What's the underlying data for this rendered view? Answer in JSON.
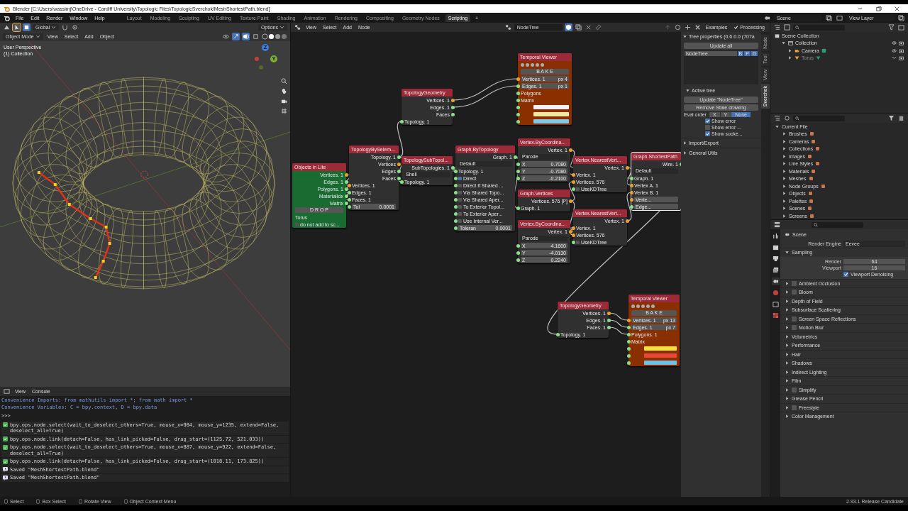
{
  "window": {
    "title": "Blender [C:\\Users\\wassimj\\OneDrive - Cardiff University\\Topologic Files\\TopologicSverchok\\MeshShortestPath.blend]"
  },
  "menu": [
    "File",
    "Edit",
    "Render",
    "Window",
    "Help"
  ],
  "workspaces": [
    {
      "label": "Layout",
      "selected": false
    },
    {
      "label": "Modeling",
      "selected": false
    },
    {
      "label": "Sculpting",
      "selected": false
    },
    {
      "label": "UV Editing",
      "selected": false
    },
    {
      "label": "Texture Paint",
      "selected": false
    },
    {
      "label": "Shading",
      "selected": false
    },
    {
      "label": "Animation",
      "selected": false
    },
    {
      "label": "Rendering",
      "selected": false
    },
    {
      "label": "Compositing",
      "selected": false
    },
    {
      "label": "Geometry Nodes",
      "selected": false
    },
    {
      "label": "Scripting",
      "selected": true
    }
  ],
  "add_tab": "+",
  "scene": "Scene",
  "view_layer": "View Layer",
  "viewport": {
    "transform": "Global",
    "options": "Options",
    "mode": "Object Mode",
    "menu": [
      "View",
      "Select",
      "Add",
      "Object"
    ],
    "overlay": [
      "User Perspective",
      "(1) Collection"
    ],
    "gizmo": [
      "Z",
      "Y"
    ]
  },
  "console": {
    "menu": [
      "View",
      "Console"
    ],
    "lines": [
      {
        "kind": "info",
        "text": "Convenience Imports:   from mathutils import *; from math import *"
      },
      {
        "kind": "info",
        "text": "Convenience Variables: C = bpy.context, D = bpy.data"
      },
      {
        "kind": "prompt",
        "text": ">>>"
      },
      {
        "kind": "op",
        "text": "bpy.ops.node.select(wait_to_deselect_others=True, mouse_x=984, mouse_y=1235, extend=False, deselect_all=True)"
      },
      {
        "kind": "op",
        "text": "bpy.ops.node.link(detach=False, has_link_picked=False, drag_start=(1125.72, 521.033))"
      },
      {
        "kind": "op",
        "text": "bpy.ops.node.select(wait_to_deselect_others=True, mouse_x=887, mouse_y=922, extend=False, deselect_all=True)"
      },
      {
        "kind": "op",
        "text": "bpy.ops.node.link(detach=False, has_link_picked=False, drag_start=(1018.11, 173.825))"
      },
      {
        "kind": "saved",
        "text": "Saved \"MeshShortestPath.blend\""
      },
      {
        "kind": "saved",
        "text": "Saved \"MeshShortestPath.blend\""
      }
    ]
  },
  "node_editor": {
    "menu": [
      "View",
      "Select",
      "Add",
      "Node"
    ],
    "tree": "NodeTree",
    "examples": "Examples",
    "processing": {
      "label": "Processing",
      "checked": true
    },
    "nodes": [
      {
        "title": "Objects in Lite",
        "kind": "objects",
        "selected": false,
        "rows": [
          {
            "kind": "socket",
            "input": false,
            "output": true,
            "text": "Vertices. 1"
          },
          {
            "kind": "socket",
            "input": false,
            "output": true,
            "text": "Edges. 1"
          },
          {
            "kind": "socket",
            "input": false,
            "output": true,
            "text": "Polygons. 1"
          },
          {
            "kind": "socket",
            "input": false,
            "output": true,
            "text": "MaterialIdx"
          },
          {
            "kind": "socket",
            "input": false,
            "output": true,
            "text": "Matrix"
          },
          {
            "kind": "button",
            "input": false,
            "output": false,
            "text": "D R O P"
          },
          {
            "kind": "socket",
            "input": false,
            "output": false,
            "text": "Torus"
          },
          {
            "kind": "check",
            "input": false,
            "output": false,
            "text": "do not add to sc...",
            "checked": false
          }
        ]
      },
      {
        "title": "TopologyBySelem...",
        "kind": "normal",
        "selected": false,
        "rows": [
          {
            "kind": "socket",
            "input": false,
            "output": true,
            "text": "Topology. 1"
          },
          {
            "kind": "socket",
            "input": false,
            "output": true,
            "text": "Vertices"
          },
          {
            "kind": "socket",
            "input": false,
            "output": true,
            "text": "Edges"
          },
          {
            "kind": "socket",
            "input": false,
            "output": true,
            "text": "Faces"
          },
          {
            "kind": "socket",
            "input": true,
            "output": false,
            "text": "Vertices. 1"
          },
          {
            "kind": "socket",
            "input": true,
            "output": false,
            "text": "Edges. 1"
          },
          {
            "kind": "socket",
            "input": true,
            "output": false,
            "text": "Faces. 1"
          },
          {
            "kind": "field",
            "input": true,
            "output": false,
            "text": "Tol",
            "value": "0.0001"
          }
        ]
      },
      {
        "title": "TopologyGeometry",
        "kind": "normal",
        "selected": false,
        "rows": [
          {
            "kind": "socket",
            "input": false,
            "output": true,
            "text": "Vertices. 1"
          },
          {
            "kind": "socket",
            "input": false,
            "output": true,
            "text": "Edges. 1"
          },
          {
            "kind": "socket",
            "input": false,
            "output": true,
            "text": "Faces"
          },
          {
            "kind": "socket",
            "input": true,
            "output": false,
            "text": "Topology. 1"
          }
        ]
      },
      {
        "title": "Temporal Viewer",
        "kind": "viewer",
        "selected": false,
        "rows": [
          {
            "kind": "button",
            "input": false,
            "output": false,
            "text": "B A K E"
          },
          {
            "kind": "field",
            "input": true,
            "output": false,
            "text": "Vertices. 1",
            "value": "px 4"
          },
          {
            "kind": "field",
            "input": true,
            "output": false,
            "text": "Edges. 1",
            "value": "px 1"
          },
          {
            "kind": "socket",
            "input": true,
            "output": false,
            "text": "Polygons"
          },
          {
            "kind": "socket",
            "input": true,
            "output": false,
            "text": "Matrix"
          },
          {
            "kind": "swatch",
            "input": true,
            "output": false,
            "color": "#f4f0f8"
          },
          {
            "kind": "swatch",
            "input": true,
            "output": false,
            "color": "#f0e8a0"
          },
          {
            "kind": "swatch",
            "input": true,
            "output": false,
            "color": "#80c8e8"
          }
        ]
      },
      {
        "title": "TopologySubTopol...",
        "kind": "normal",
        "selected": false,
        "rows": [
          {
            "kind": "socket",
            "input": false,
            "output": true,
            "text": "SubTopologies. 1"
          },
          {
            "kind": "dropdown",
            "input": false,
            "output": false,
            "text": "Shell"
          },
          {
            "kind": "socket",
            "input": true,
            "output": false,
            "text": "Topology. 1"
          }
        ]
      },
      {
        "title": "Graph.ByTopology",
        "kind": "normal",
        "selected": false,
        "rows": [
          {
            "kind": "socket",
            "input": false,
            "output": true,
            "text": "Graph. 1"
          },
          {
            "kind": "dropdown",
            "input": false,
            "output": false,
            "text": "Default"
          },
          {
            "kind": "socket",
            "input": true,
            "output": false,
            "text": "Topology. 1"
          },
          {
            "kind": "check",
            "input": true,
            "output": false,
            "text": "Direct",
            "checked": true
          },
          {
            "kind": "check",
            "input": true,
            "output": false,
            "text": "Direct If Shared ...",
            "checked": false
          },
          {
            "kind": "check",
            "input": true,
            "output": false,
            "text": "Via Shared Topo...",
            "checked": false
          },
          {
            "kind": "check",
            "input": true,
            "output": false,
            "text": "Via Shared Aper...",
            "checked": false
          },
          {
            "kind": "check",
            "input": true,
            "output": false,
            "text": "To Exterior Topol...",
            "checked": false
          },
          {
            "kind": "check",
            "input": true,
            "output": false,
            "text": "To Exterior Aper...",
            "checked": false
          },
          {
            "kind": "check",
            "input": true,
            "output": false,
            "text": "Use Internal Ver...",
            "checked": false
          },
          {
            "kind": "field",
            "input": true,
            "output": false,
            "text": "Toleran",
            "value": "0.0001"
          }
        ]
      },
      {
        "title": "Vertex.ByCoordina...",
        "kind": "normal",
        "selected": false,
        "rows": [
          {
            "kind": "socket",
            "input": false,
            "output": true,
            "text": "Vertex. 1"
          },
          {
            "kind": "dropdown",
            "input": false,
            "output": false,
            "text": "Parode"
          },
          {
            "kind": "field",
            "input": true,
            "output": false,
            "text": "X",
            "value": "0.7080"
          },
          {
            "kind": "field",
            "input": true,
            "output": false,
            "text": "Y",
            "value": "-0.7080"
          },
          {
            "kind": "field",
            "input": true,
            "output": false,
            "text": "Z",
            "value": "-0.2100"
          }
        ]
      },
      {
        "title": "Graph.Vertices",
        "kind": "normal",
        "selected": false,
        "rows": [
          {
            "kind": "socket",
            "input": false,
            "output": true,
            "text": "Vertices. 576 [P]"
          },
          {
            "kind": "socket",
            "input": true,
            "output": false,
            "text": "Graph. 1"
          }
        ]
      },
      {
        "title": "Vertex.NearestVert...",
        "kind": "normal",
        "selected": false,
        "rows": [
          {
            "kind": "socket",
            "input": false,
            "output": true,
            "text": "Vertex. 1"
          },
          {
            "kind": "socket",
            "input": true,
            "output": false,
            "text": "Vertex. 1"
          },
          {
            "kind": "socket",
            "input": true,
            "output": false,
            "text": "Vertices. 576"
          },
          {
            "kind": "check",
            "input": true,
            "output": false,
            "text": "UseKDTree",
            "checked": false
          }
        ]
      },
      {
        "title": "Vertex.NearestVert...",
        "kind": "normal",
        "selected": false,
        "rows": [
          {
            "kind": "socket",
            "input": false,
            "output": true,
            "text": "Vertex. 1"
          },
          {
            "kind": "socket",
            "input": true,
            "output": false,
            "text": "Vertex. 1"
          },
          {
            "kind": "socket",
            "input": true,
            "output": false,
            "text": "Vertices. 576"
          },
          {
            "kind": "check",
            "input": true,
            "output": false,
            "text": "UseKDTree",
            "checked": false
          }
        ]
      },
      {
        "title": "Vertex.ByCoordina...",
        "kind": "normal",
        "selected": false,
        "rows": [
          {
            "kind": "socket",
            "input": false,
            "output": true,
            "text": "Vertex. 1"
          },
          {
            "kind": "dropdown",
            "input": false,
            "output": false,
            "text": "Parode"
          },
          {
            "kind": "field",
            "input": true,
            "output": false,
            "text": "X",
            "value": "4.1600"
          },
          {
            "kind": "field",
            "input": true,
            "output": false,
            "text": "Y",
            "value": "-4.0130"
          },
          {
            "kind": "field",
            "input": true,
            "output": false,
            "text": "Z",
            "value": "0.2240"
          }
        ]
      },
      {
        "title": "Graph.ShortestPath",
        "kind": "normal",
        "selected": true,
        "rows": [
          {
            "kind": "socket",
            "input": false,
            "output": true,
            "text": "Wire. 1"
          },
          {
            "kind": "dropdown",
            "input": false,
            "output": false,
            "text": "Default"
          },
          {
            "kind": "socket",
            "input": true,
            "output": false,
            "text": "Graph. 1"
          },
          {
            "kind": "socket",
            "input": true,
            "output": false,
            "text": "Vertex A. 1"
          },
          {
            "kind": "socket",
            "input": true,
            "output": false,
            "text": "Vertex B. 1"
          },
          {
            "kind": "field",
            "input": true,
            "output": false,
            "text": "Verte..."
          },
          {
            "kind": "field",
            "input": true,
            "output": false,
            "text": "Edge..."
          }
        ]
      },
      {
        "title": "TopologyGeometry",
        "kind": "normal",
        "selected": false,
        "rows": [
          {
            "kind": "socket",
            "input": false,
            "output": true,
            "text": "Vertices. 1"
          },
          {
            "kind": "socket",
            "input": false,
            "output": true,
            "text": "Edges. 1"
          },
          {
            "kind": "socket",
            "input": false,
            "output": true,
            "text": "Faces. 1"
          },
          {
            "kind": "socket",
            "input": true,
            "output": false,
            "text": "Topology. 1"
          }
        ]
      },
      {
        "title": "Temporal Viewer",
        "kind": "viewer",
        "selected": false,
        "rows": [
          {
            "kind": "button",
            "input": false,
            "output": false,
            "text": "B A K E"
          },
          {
            "kind": "field",
            "input": true,
            "output": false,
            "text": "Vertices. 1",
            "value": "px 13"
          },
          {
            "kind": "field",
            "input": true,
            "output": false,
            "text": "Edges. 1",
            "value": "px 7"
          },
          {
            "kind": "socket",
            "input": true,
            "output": false,
            "text": "Polygons. 1"
          },
          {
            "kind": "socket",
            "input": true,
            "output": false,
            "text": "Matrix"
          },
          {
            "kind": "swatch",
            "input": true,
            "output": false,
            "color": "#f8e040"
          },
          {
            "kind": "swatch",
            "input": true,
            "output": false,
            "color": "#e84838"
          },
          {
            "kind": "swatch",
            "input": true,
            "output": false,
            "color": "#70c0e8"
          }
        ]
      }
    ]
  },
  "sidebar": {
    "title": "Tree properties (0.6.0.0 (707a",
    "update_all": "Update all",
    "tree_item": {
      "name": "NodeTree",
      "flags": [
        "B",
        "P",
        "D"
      ]
    },
    "active_tree": "Active tree",
    "update_tree": "Update \"NodeTree\"",
    "remove_stale": "Remove Stale drawing",
    "eval_order": {
      "label": "Eval order",
      "options": [
        {
          "label": "X",
          "selected": false
        },
        {
          "label": "Y",
          "selected": false
        },
        {
          "label": "None",
          "selected": true
        }
      ]
    },
    "checks": [
      {
        "label": "Show error",
        "checked": true
      },
      {
        "label": "Show error ...",
        "checked": false
      },
      {
        "label": "Show socke...",
        "checked": true
      }
    ],
    "panels": [
      "Import/Export",
      "General Utils"
    ],
    "tabs": [
      {
        "label": "Node",
        "selected": false
      },
      {
        "label": "Tool",
        "selected": false
      },
      {
        "label": "View",
        "selected": false
      },
      {
        "label": "Sverchok",
        "selected": true
      }
    ]
  },
  "outliner": {
    "items": [
      {
        "label": "Scene Collection",
        "kind": "scene",
        "children": [
          {
            "label": "Collection",
            "kind": "collection",
            "visible": true,
            "children": [
              {
                "label": "Camera",
                "kind": "camera",
                "visible": true
              },
              {
                "label": "Torus",
                "kind": "mesh",
                "visible": false
              }
            ]
          }
        ]
      }
    ]
  },
  "blend_file": {
    "root": "Current File",
    "items": [
      "Brushes",
      "Cameras",
      "Collections",
      "Images",
      "Line Styles",
      "Materials",
      "Meshes",
      "Node Groups",
      "Objects",
      "Palettes",
      "Scenes",
      "Screens"
    ]
  },
  "properties": {
    "context": "Scene",
    "render_engine": {
      "label": "Render Engine",
      "value": "Eevee"
    },
    "sampling": {
      "label": "Sampling",
      "fields": [
        {
          "label": "Render",
          "value": "64"
        },
        {
          "label": "Viewport",
          "value": "16"
        }
      ],
      "denoise": {
        "label": "Viewport Denoising",
        "checked": true
      }
    },
    "panels": [
      {
        "label": "Ambient Occlusion",
        "kind": "toggle",
        "checked": false
      },
      {
        "label": "Bloom",
        "kind": "toggle",
        "checked": false
      },
      {
        "label": "Depth of Field",
        "kind": "plain"
      },
      {
        "label": "Subsurface Scattering",
        "kind": "plain"
      },
      {
        "label": "Screen Space Reflections",
        "kind": "toggle",
        "checked": false
      },
      {
        "label": "Motion Blur",
        "kind": "toggle",
        "checked": false
      },
      {
        "label": "Volumetrics",
        "kind": "plain"
      },
      {
        "label": "Performance",
        "kind": "plain"
      },
      {
        "label": "Hair",
        "kind": "plain"
      },
      {
        "label": "Shadows",
        "kind": "plain"
      },
      {
        "label": "Indirect Lighting",
        "kind": "plain"
      },
      {
        "label": "Film",
        "kind": "plain"
      },
      {
        "label": "Simplify",
        "kind": "toggle",
        "checked": false
      },
      {
        "label": "Grease Pencil",
        "kind": "plain"
      },
      {
        "label": "Freestyle",
        "kind": "toggle",
        "checked": false
      },
      {
        "label": "Color Management",
        "kind": "plain"
      }
    ]
  },
  "status_bar": {
    "items": [
      "Select",
      "Box Select",
      "Rotate View",
      "Object Context Menu"
    ],
    "version": "2.93.1 Release Candidate"
  }
}
